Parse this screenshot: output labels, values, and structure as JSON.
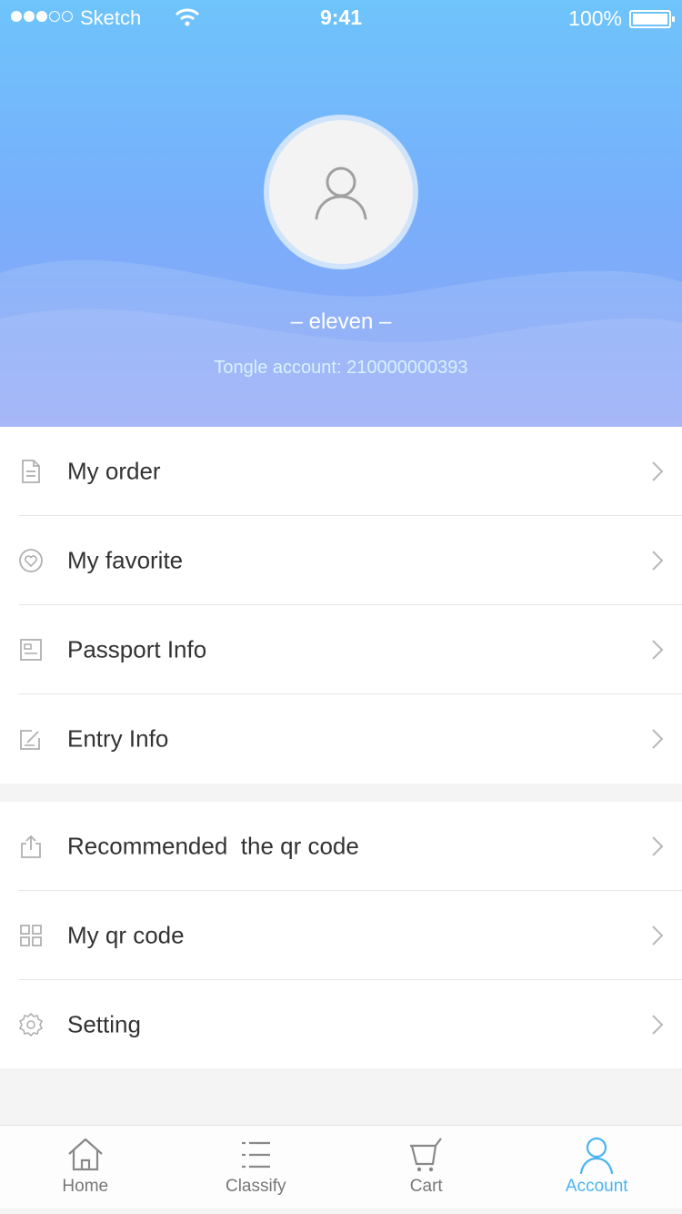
{
  "status_bar": {
    "carrier": "Sketch",
    "time": "9:41",
    "battery": "100%"
  },
  "profile": {
    "username": "– eleven –",
    "account": "Tongle account: 210000000393"
  },
  "menu": {
    "group1": [
      {
        "label": "My order",
        "icon": "document-icon"
      },
      {
        "label": "My favorite",
        "icon": "heart-icon"
      },
      {
        "label": "Passport Info",
        "icon": "id-card-icon"
      },
      {
        "label": "Entry Info",
        "icon": "edit-icon"
      }
    ],
    "group2": [
      {
        "label": "Recommended  the qr code",
        "icon": "share-icon"
      },
      {
        "label": "My qr code",
        "icon": "grid-icon"
      },
      {
        "label": "Setting",
        "icon": "gear-icon"
      }
    ]
  },
  "tabs": [
    {
      "label": "Home",
      "icon": "home-icon"
    },
    {
      "label": "Classify",
      "icon": "list-icon"
    },
    {
      "label": "Cart",
      "icon": "cart-icon"
    },
    {
      "label": "Account",
      "icon": "user-icon",
      "active": true
    }
  ],
  "colors": {
    "accent": "#4ab4f0",
    "text": "#333333",
    "username": "#FFFFFF",
    "account": "#D9F1FF"
  }
}
